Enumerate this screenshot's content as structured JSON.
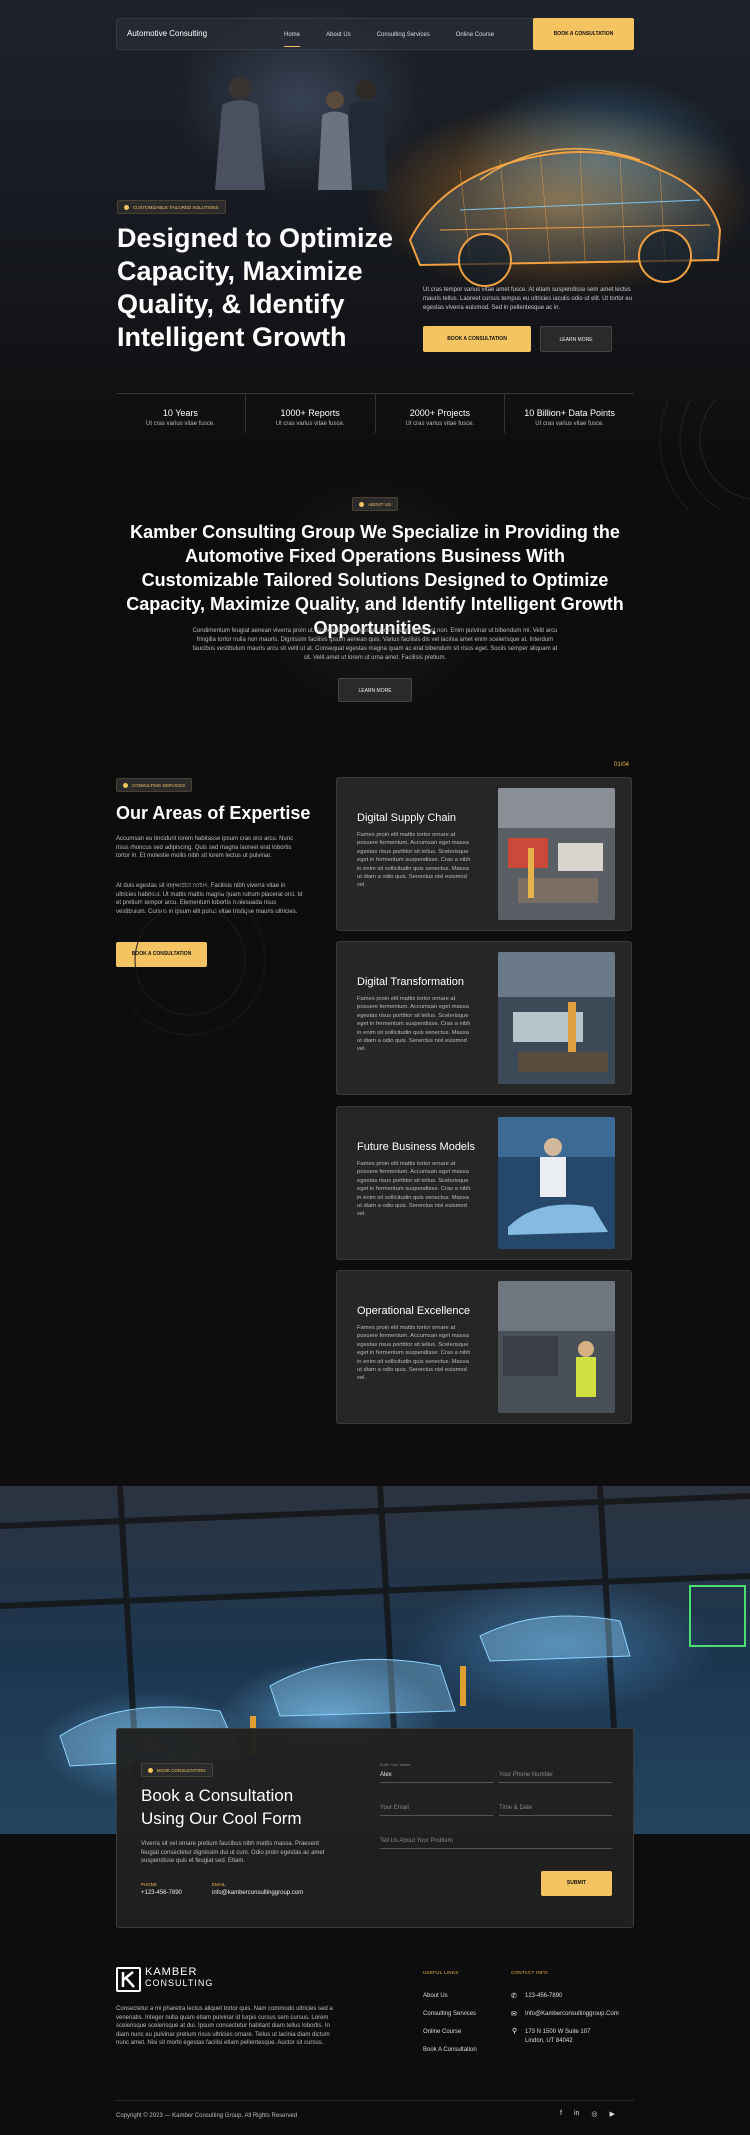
{
  "nav": {
    "brand": "Automotive Consulting",
    "links": [
      "Home",
      "About Us",
      "Consulting Services",
      "Online Course"
    ],
    "cta": "BOOK A CONSULTATION"
  },
  "hero": {
    "tag": "CUSTOMIZABLE TAILORED SOLUTIONS",
    "title": "Designed to Optimize Capacity, Maximize Quality, & Identify Intelligent Growth",
    "description": "Ut cras tempor varius vitae amet fusce. At etiam suspendisse sem amet lectus mauris tellus. Laoreet cursus tempus eu ultricies iaculis odio ut elit. Ut tortor eu egestas viverra euismod. Sed in pellentesque ac in.",
    "cta_primary": "BOOK A CONSULTATION",
    "cta_secondary": "LEARN MORE"
  },
  "stats": [
    {
      "value": "10 Years",
      "sub": "Ut cras varius vitae fusce."
    },
    {
      "value": "1000+ Reports",
      "sub": "Ut cras varius vitae fusce."
    },
    {
      "value": "2000+ Projects",
      "sub": "Ut cras varius vitae fusce."
    },
    {
      "value": "10 Billion+ Data Points",
      "sub": "Ut cras varius vitae fusce."
    }
  ],
  "about": {
    "tag": "ABOUT US",
    "title": "Kamber Consulting Group We Specialize in Providing the Automotive Fixed Operations Business With Customizable Tailored Solutions Designed to Optimize Capacity, Maximize Quality, and Identify Intelligent Growth Opportunities.",
    "description": "Condimentum feugiat aenean viverra proin ut. Scelerisque sit egestas lorem quam enim est non. Enim pulvinar ut bibendum mi. Velit arcu fringilla tortor nulla non mauris. Dignissim facilisis ipsum aenean quis. Varius facilisis dis vel lacinia amet enim scelerisque at. Interdum faucibus vestibulum mauris arcu sit velit ut at. Consequat egestas magna quam ac erat bibendum sit risus eget. Sociis semper aliquam at sit. Velit amet ut lorem ut urna amet. Facilisis pretium.",
    "cta": "LEARN MORE"
  },
  "expertise": {
    "tag": "CONSULTING SERVICES",
    "title": "Our Areas of Expertise",
    "p1": "Accumsan eu tincidunt lorem habitasse ipsum cras orci arcu. Nunc risus rhoncus sed adipiscing. Quis sed magna laoreet erat lobortis tortor in. Et molestie mollis nibh sit lorem lectus ut pulvinar.",
    "p2": "At duis egestas sit imperdiet netus. Facilisis nibh viverra vitae in ultricies habitant. Ut mattis mattis magna quam rutrum placerat orci. Id et pretium tempor arcu. Elementum lobortis malesuada risus vestibulum. Cursus in ipsum elit purus vitae tristique mauris ultricies.",
    "cta": "BOOK A CONSULTATION",
    "counter": "01/04",
    "cards": [
      {
        "title": "Digital Supply Chain",
        "desc": "Fames proin elit mattis tortor ornare at posuere fermentum. Accumsan eget massa egestas risus porttitor sit tellus. Scelerisque eget in fermentum suspendisse. Cras a nibh in enim sit sollicitudin quis senectus. Massa ut diam a odio quis. Senectus nisl euismod vel."
      },
      {
        "title": "Digital Transformation",
        "desc": "Fames proin elit mattis tortor ornare at posuere fermentum. Accumsan eget massa egestas risus porttitor sit tellus. Scelerisque eget in fermentum suspendisse. Cras a nibh in enim sit sollicitudin quis senectus. Massa ut diam a odio quis. Senectus nisl euismod vel."
      },
      {
        "title": "Future Business Models",
        "desc": "Fames proin elit mattis tortor ornare at posuere fermentum. Accumsan eget massa egestas risus porttitor sit tellus. Scelerisque eget in fermentum suspendisse. Cras a nibh in enim sit sollicitudin quis senectus. Massa ut diam a odio quis. Senectus nisl euismod vel."
      },
      {
        "title": "Operational Excellence",
        "desc": "Fames proin elit mattis tortor ornare at posuere fermentum. Accumsan eget massa egestas risus porttitor sit tellus. Scelerisque eget in fermentum suspendisse. Cras a nibh in enim sit sollicitudin quis senectus. Massa ut diam a odio quis. Senectus nisl euismod vel."
      }
    ]
  },
  "consult": {
    "tag": "BOOK CONSULTATION",
    "title": "Book a Consultation Using Our Cool Form",
    "desc": "Viverra sit vel ornare pretium faucibus nibh mattis massa. Praesent feugiat consectetur dignissim dui ut cum. Odio proin egestas ac amet suspendisse quis et feugiat sed. Etiam.",
    "phone_label": "PHONE",
    "phone": "+123-456-7890",
    "email_label": "EMAIL",
    "email": "info@kamberconsultinggroup.com",
    "name_label": "Enter Your Name",
    "name_value": "Alex",
    "phone_placeholder": "Your Phone Number",
    "email_placeholder": "Your Email",
    "time_placeholder": "Time & Date",
    "message_placeholder": "Tell Us About Your Problem",
    "submit": "SUBMIT"
  },
  "footer": {
    "logo_line1": "KAMBER",
    "logo_line2": "CONSULTING",
    "desc": "Consectetur a mi pharetra lectus aliquet tortor quis. Nam commodo ultricies sed a venenatis. Integer nulla quam etiam pulvinar id turpis cursus sem cursus. Lorem scelerisque scelerisque at dui. Ipsum consectetur habitant diam tellus lobortis. In diam nunc eu pulvinar pretium risus ultricies ornare. Tellus ut lacinia diam dictum nunc amet. Nisi sit morbi egestas facilisi etiam pellentesque. Auctor sit cursus.",
    "useful_links_head": "USEFUL LINKS",
    "useful_links": [
      "About Us",
      "Consulting Services",
      "Online Course",
      "Book A Consultation"
    ],
    "contact_head": "CONTACT INFO",
    "contact_phone": "123-456-7890",
    "contact_email": "Info@Kamberconsultinggroup.Com",
    "address_line1": "173 N 1500 W Suite 107",
    "address_line2": "Lindon, UT 84042",
    "copyright": "Copyright © 2023 — Kamber Consulting Group. All Rights Reserved"
  },
  "colors": {
    "accent": "#f5c462",
    "background": "#0d0d0d",
    "card": "#262626"
  }
}
